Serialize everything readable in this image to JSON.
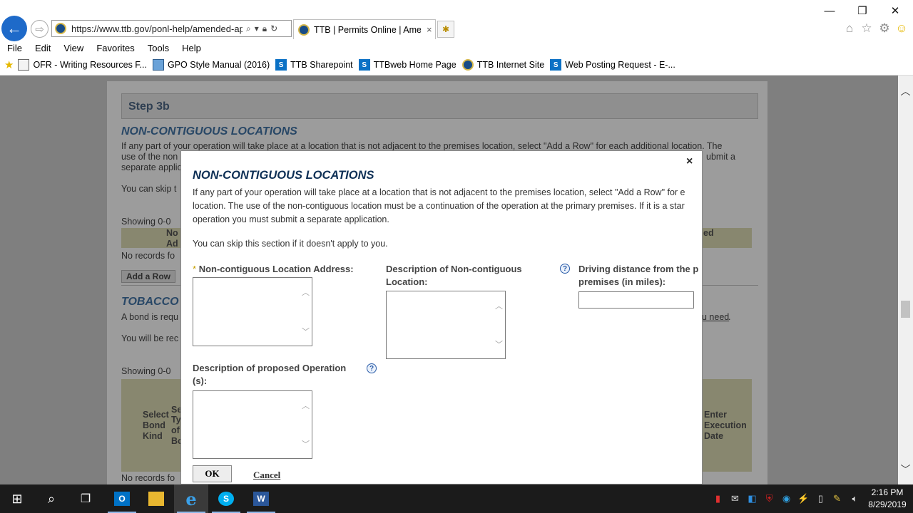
{
  "browser": {
    "url": "https://www.ttb.gov/ponl-help/amended-app",
    "tab_title": "TTB | Permits Online | Ame...",
    "tab_close": "×",
    "menu": [
      "File",
      "Edit",
      "View",
      "Favorites",
      "Tools",
      "Help"
    ],
    "favorites": [
      {
        "label": "OFR - Writing Resources F...",
        "icon": "document-icon"
      },
      {
        "label": "GPO Style Manual (2016)",
        "icon": "gpo-icon"
      },
      {
        "label": "TTB Sharepoint",
        "icon": "sharepoint-icon"
      },
      {
        "label": "TTBweb Home Page",
        "icon": "sharepoint-icon"
      },
      {
        "label": "TTB Internet Site",
        "icon": "ttb-seal-icon"
      },
      {
        "label": "Web Posting Request - E-...",
        "icon": "sharepoint-icon"
      }
    ]
  },
  "page": {
    "step_label": "Step 3b",
    "section1_heading": "NON-CONTIGUOUS LOCATIONS",
    "section1_text_1": "If any part of your operation will take place at a location that is not adjacent to the premises location, select \"Add a Row\" for each additional location. The",
    "section1_text_2": "use of the non",
    "section1_text_2b": "ubmit a",
    "section1_text_3": "separate applic",
    "section1_skip": "You can skip t",
    "showing_1": "Showing 0-0",
    "col_1": "No",
    "col_1b": "Ad",
    "col_right": "ed",
    "no_records_1": "No records fo",
    "add_row": "Add a Row",
    "section2_heading": "TOBACCO",
    "bond_text": "A bond is requ",
    "bond_link": "u need",
    "bond_period": ".",
    "will_text": "You will be rec",
    "showing_2": "Showing 0-0",
    "col_select_bond": "Select Bond Kind",
    "col_sel_1": "Se",
    "col_sel_2": "Ty",
    "col_sel_3": "of",
    "col_sel_4": "Bo",
    "col_exec": "Enter Execution Date",
    "no_records_2": "No records fo"
  },
  "modal": {
    "close": "×",
    "title": "NON-CONTIGUOUS LOCATIONS",
    "intro_line_1": "If any part of your operation will take place at a location that is not adjacent to the premises location, select \"Add a Row\" for e",
    "intro_line_2": "location. The use of the non-contiguous location must be a continuation of the operation at the primary premises. If it is a star",
    "intro_line_3": "operation you must submit a separate application.",
    "skip_text": "You can skip this section if it doesn't apply to you.",
    "required_marker": "*",
    "address_label": "Non-contiguous Location Address:",
    "address_value": "",
    "description_label_1": "Description of Non-contiguous",
    "description_label_2": "Location:",
    "description_value": "",
    "help_glyph": "?",
    "distance_label_1": "Driving distance from the p",
    "distance_label_2": "premises (in miles):",
    "distance_value": "",
    "operation_label_1": "Description of proposed Operation",
    "operation_label_2": "(s):",
    "operation_value": "",
    "ok_label": "OK",
    "cancel_label": "Cancel"
  },
  "taskbar": {
    "time": "2:16 PM",
    "date": "8/29/2019"
  }
}
